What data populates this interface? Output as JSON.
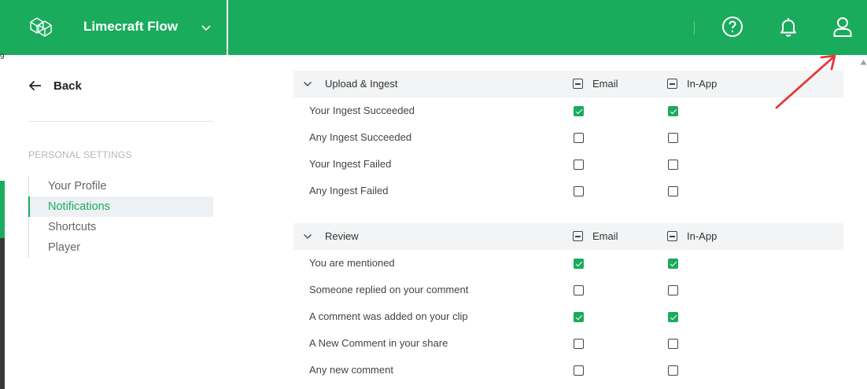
{
  "app": {
    "title": "Limecraft Flow"
  },
  "topbar": {
    "icons": {
      "logo": "cubes-logo-icon",
      "help": "help-circle-icon",
      "bell": "bell-icon",
      "user": "user-icon"
    }
  },
  "sidebar": {
    "back_label": "Back",
    "section_label": "PERSONAL SETTINGS",
    "items": [
      {
        "label": "Your Profile",
        "active": false
      },
      {
        "label": "Notifications",
        "active": true
      },
      {
        "label": "Shortcuts",
        "active": false
      },
      {
        "label": "Player",
        "active": false
      }
    ]
  },
  "groups": [
    {
      "title": "Upload & Ingest",
      "email_header": "Email",
      "inapp_header": "In-App",
      "rows": [
        {
          "label": "Your Ingest Succeeded",
          "email": true,
          "inapp": true
        },
        {
          "label": "Any Ingest Succeeded",
          "email": false,
          "inapp": false
        },
        {
          "label": "Your Ingest Failed",
          "email": false,
          "inapp": false
        },
        {
          "label": "Any Ingest Failed",
          "email": false,
          "inapp": false
        }
      ]
    },
    {
      "title": "Review",
      "email_header": "Email",
      "inapp_header": "In-App",
      "rows": [
        {
          "label": "You are mentioned",
          "email": true,
          "inapp": true
        },
        {
          "label": "Someone replied on your comment",
          "email": false,
          "inapp": false
        },
        {
          "label": "A comment was added on your clip",
          "email": true,
          "inapp": true
        },
        {
          "label": "A New Comment in your share",
          "email": false,
          "inapp": false
        },
        {
          "label": "Any new comment",
          "email": false,
          "inapp": false
        }
      ]
    }
  ],
  "colors": {
    "brand": "#1aab5d",
    "annotation": "#e53935"
  }
}
